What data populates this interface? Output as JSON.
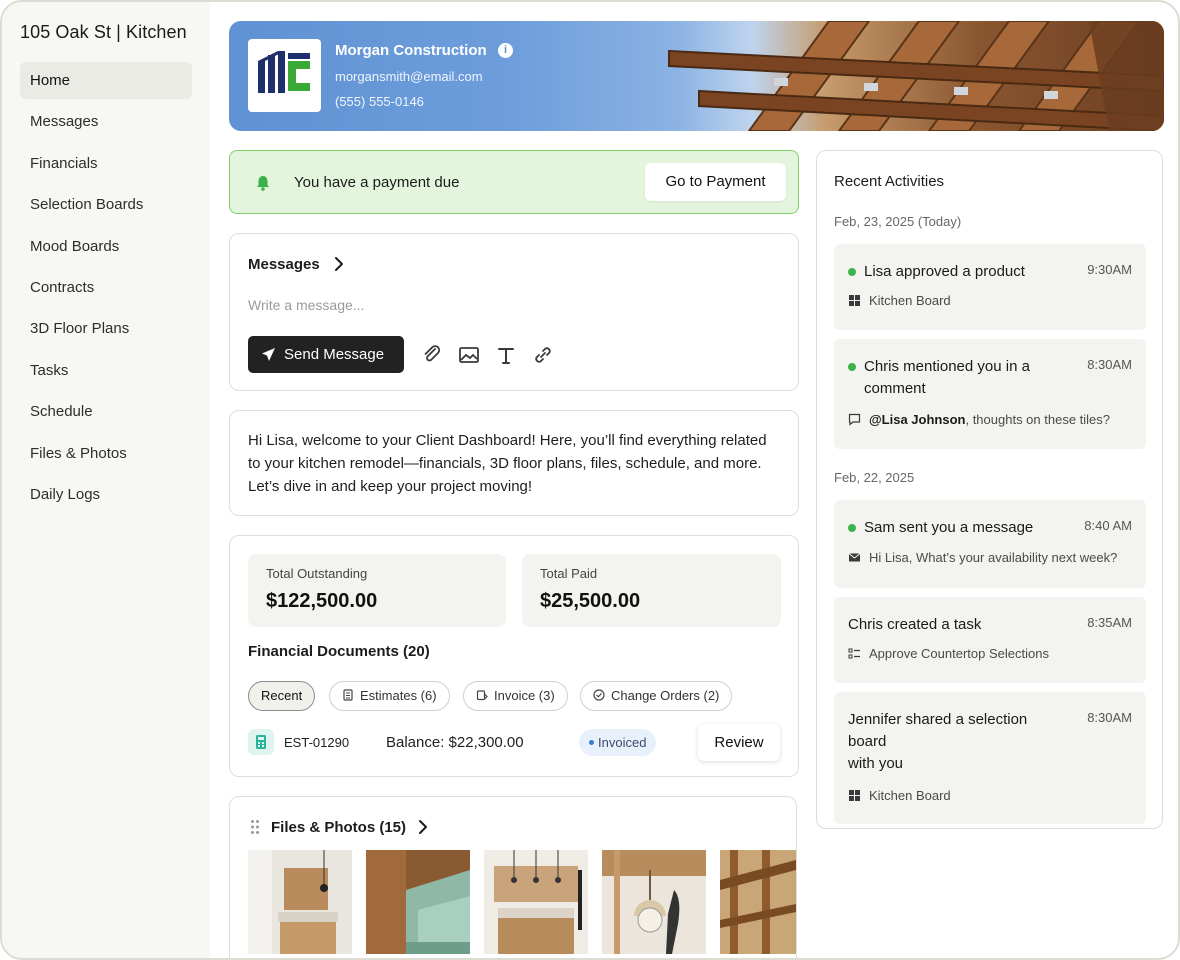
{
  "sidebar": {
    "project_title": "105 Oak St | Kitchen",
    "items": [
      {
        "label": "Home",
        "active": true
      },
      {
        "label": "Messages"
      },
      {
        "label": "Financials"
      },
      {
        "label": "Selection Boards"
      },
      {
        "label": "Mood Boards"
      },
      {
        "label": "Contracts"
      },
      {
        "label": "3D Floor Plans"
      },
      {
        "label": "Tasks"
      },
      {
        "label": "Schedule"
      },
      {
        "label": "Files & Photos"
      },
      {
        "label": "Daily Logs"
      }
    ]
  },
  "banner": {
    "company": "Morgan Construction",
    "email": "morgansmith@email.com",
    "phone": "(555) 555-0146",
    "info_icon": "i"
  },
  "payment": {
    "text": "You have a payment due",
    "button": "Go to Payment"
  },
  "messages": {
    "title": "Messages",
    "placeholder": "Write a message...",
    "send_label": "Send Message"
  },
  "welcome": {
    "text": "Hi Lisa, welcome to your Client Dashboard! Here, you’ll find everything related to your kitchen remodel—financials, 3D floor plans, files, schedule, and more. Let’s dive in and keep your project moving!"
  },
  "financials": {
    "outstanding_label": "Total Outstanding",
    "outstanding_value": "$122,500.00",
    "paid_label": "Total Paid",
    "paid_value": "$25,500.00",
    "docs_title": "Financial Documents (20)",
    "chips": [
      "Recent",
      "Estimates (6)",
      "Invoice (3)",
      "Change Orders (2)"
    ],
    "doc": {
      "id": "EST-01290",
      "balance": "Balance: $22,300.00",
      "status": "Invoiced",
      "action": "Review"
    }
  },
  "files": {
    "title": "Files & Photos (15)"
  },
  "activities": {
    "title": "Recent Activities",
    "date_today": "Feb, 23, 2025 (Today)",
    "date_prev": "Feb, 22, 2025",
    "items": [
      {
        "title": "Lisa approved a product",
        "time": "9:30AM",
        "sub": "Kitchen Board"
      },
      {
        "title": "Chris mentioned you in a comment",
        "time": "8:30AM",
        "mention": "@Lisa Johnson",
        "sub": ", thoughts on these tiles?"
      },
      {
        "title": "Sam sent you a message",
        "time": "8:40 AM",
        "sub": "Hi Lisa, What’s your availability next week?"
      },
      {
        "title": "Chris created a task",
        "time": "8:35AM",
        "sub": "Approve Countertop Selections"
      },
      {
        "title": "Jennifer shared a selection board",
        "title2": "with you",
        "time": "8:30AM",
        "sub": "Kitchen Board"
      }
    ]
  },
  "colors": {
    "accent_green": "#3bb34a",
    "alert_bg": "#e3f6dd",
    "dark_button": "#222222",
    "banner_blue": "#5f92d4"
  }
}
